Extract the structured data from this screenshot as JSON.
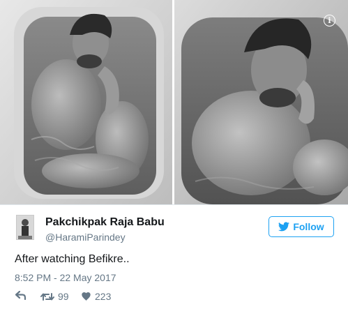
{
  "tweet": {
    "display_name": "Pakchikpak Raja Babu",
    "screen_name": "@HaramiParindey",
    "text": "After watching Befikre..",
    "timestamp": "8:52 PM - 22 May 2017",
    "follow_label": "Follow",
    "retweet_count": "99",
    "like_count": "223"
  },
  "media": {
    "info_label": "i",
    "photos": [
      {
        "description_icon": "photo-bathtub-left"
      },
      {
        "description_icon": "photo-bathtub-right"
      }
    ]
  },
  "colors": {
    "accent": "#1da1f2",
    "muted": "#657786",
    "text": "#14171a",
    "border": "#e1e8ed"
  },
  "icons": {
    "follow": "twitter-bird-icon",
    "reply": "reply-icon",
    "retweet": "retweet-icon",
    "like": "heart-icon",
    "info": "info-icon"
  }
}
